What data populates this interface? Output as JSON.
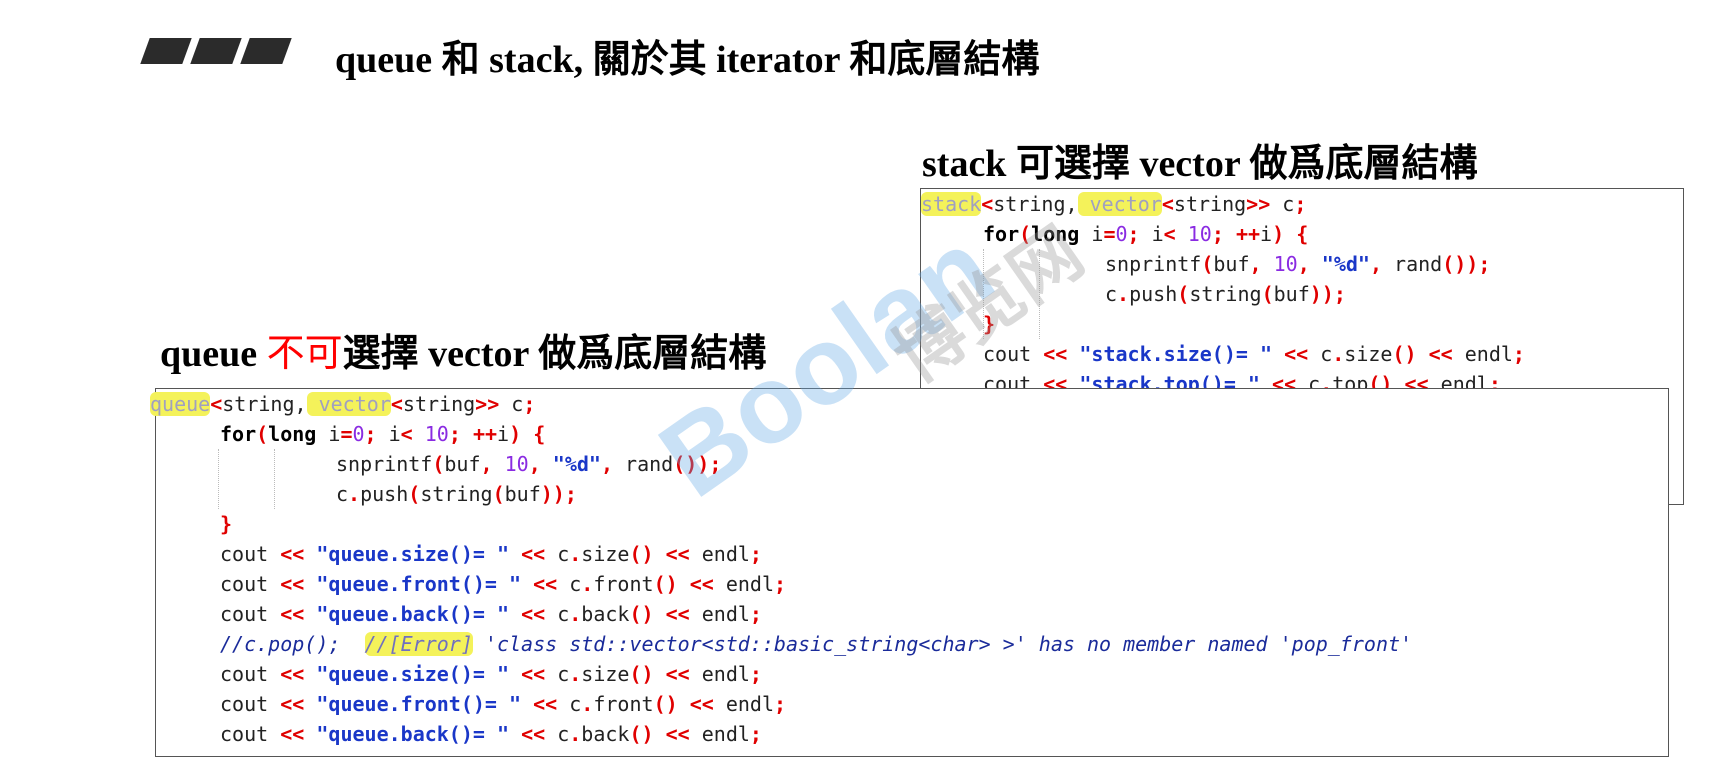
{
  "slide": {
    "title": "queue 和 stack, 關於其 iterator 和底層結構"
  },
  "stack_section": {
    "heading": "stack 可選擇 vector 做爲底層結構"
  },
  "queue_section": {
    "heading_prefix": "queue ",
    "heading_red": "不可",
    "heading_suffix": "選擇 vector 做爲底層結構"
  },
  "watermark": {
    "text1": "Boolan",
    "text2": "博览网"
  },
  "colors": {
    "keyword": "#000000",
    "operator": "#e00000",
    "string": "#1a37c8",
    "number": "#8a2be2",
    "highlight": "#f4f25a",
    "heading_red": "#ff0000"
  }
}
